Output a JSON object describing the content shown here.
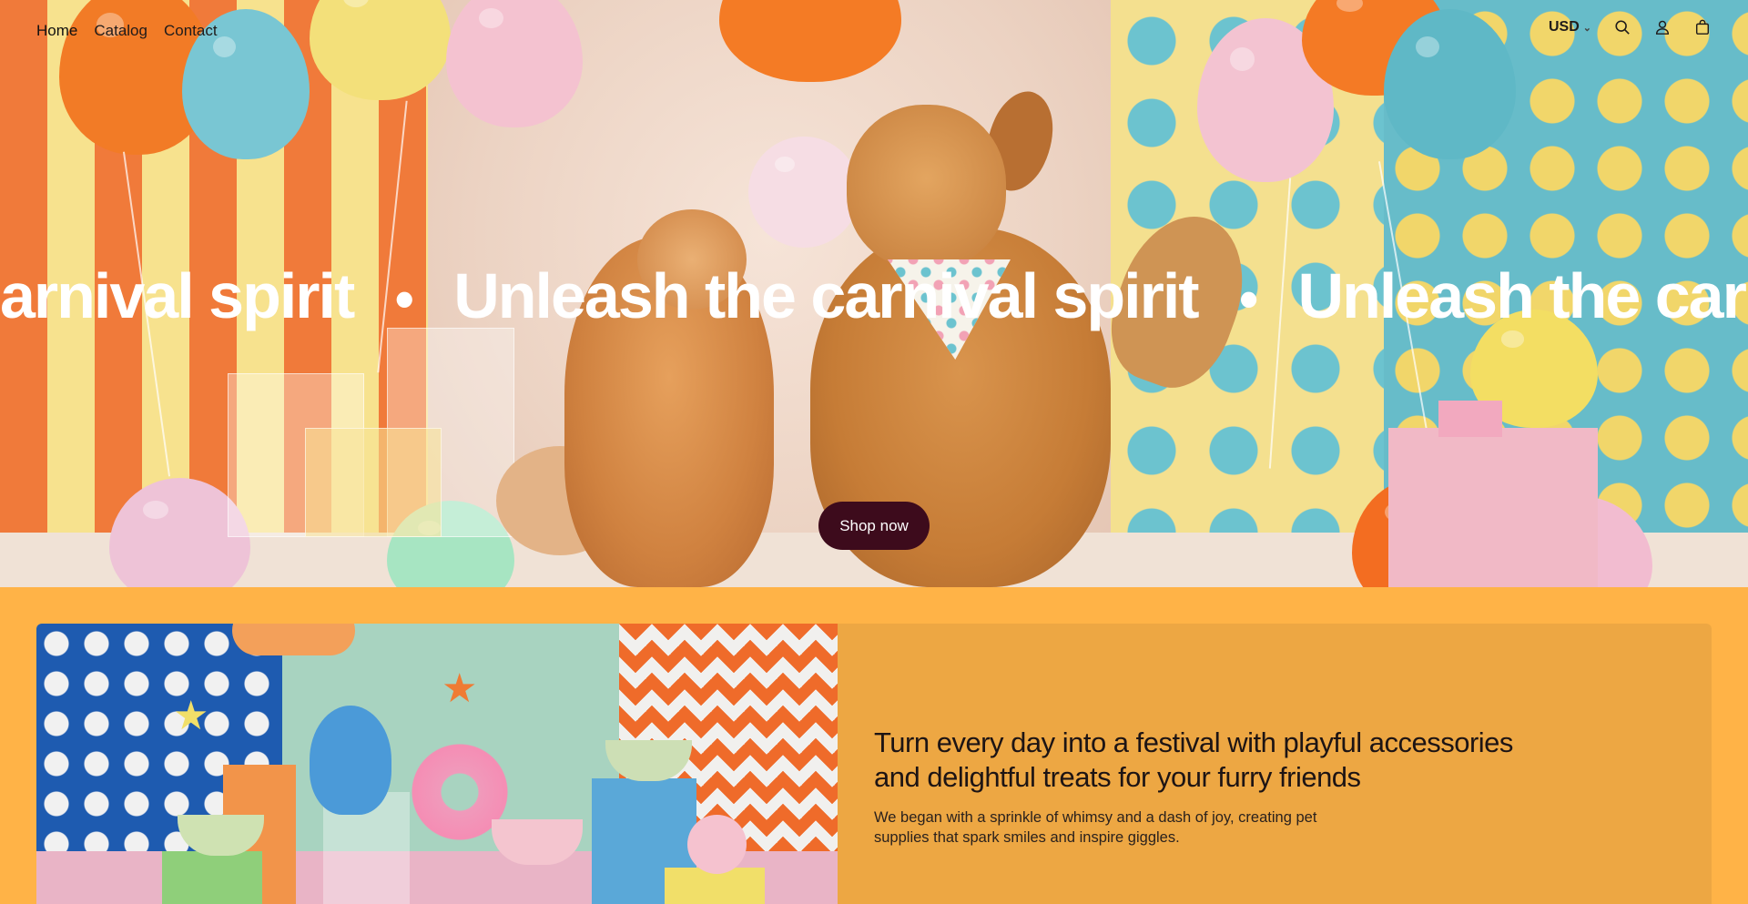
{
  "header": {
    "nav": [
      {
        "label": "Home",
        "active": true
      },
      {
        "label": "Catalog",
        "active": false
      },
      {
        "label": "Contact",
        "active": false
      }
    ],
    "currency": "USD",
    "icons": [
      "search-icon",
      "account-icon",
      "cart-icon"
    ]
  },
  "hero": {
    "marquee_text": "Unleash the carnival spirit",
    "marquee_visible_start": "arnival spirit",
    "marquee_separator": "•",
    "cta_label": "Shop now",
    "cta_color": "#3d0b1c"
  },
  "feature": {
    "title": "Turn every day into a festival with playful accessories and delightful treats for your furry friends",
    "body": "We began with a sprinkle of whimsy and a dash of joy, creating pet supplies that spark smiles and inspire giggles.",
    "background": "#EDA743"
  },
  "page": {
    "background": "#FFB347"
  }
}
